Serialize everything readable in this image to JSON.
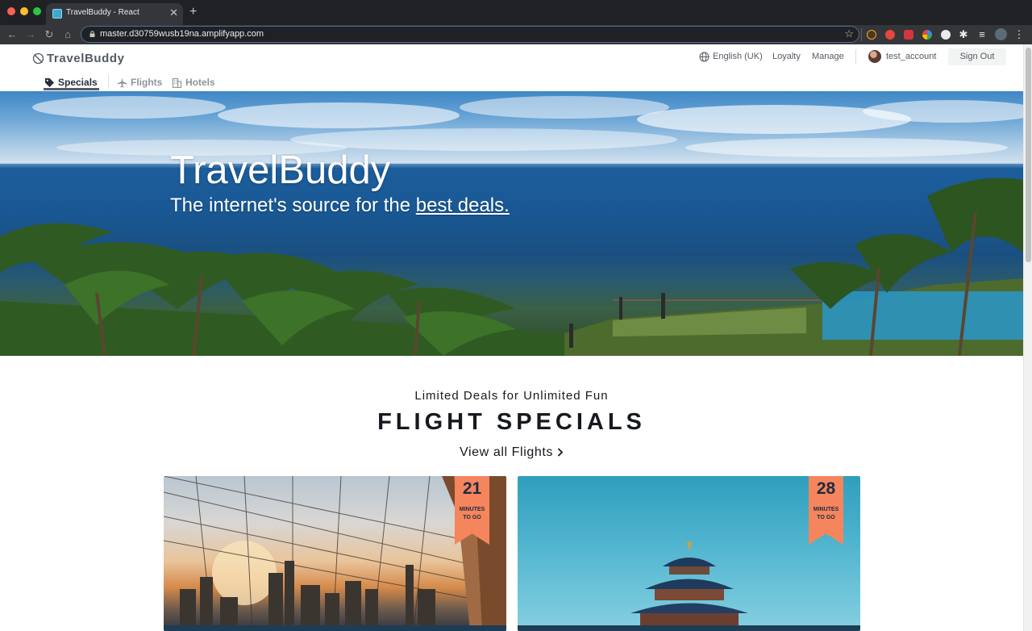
{
  "browser": {
    "tab_title": "TravelBuddy - React",
    "url": "master.d30759wusb19na.amplifyapp.com"
  },
  "header": {
    "logo_text": "TravelBuddy",
    "language": "English (UK)",
    "loyalty": "Loyalty",
    "manage": "Manage",
    "username": "test_account",
    "sign_out": "Sign Out"
  },
  "subnav": {
    "items": [
      {
        "label": "Specials",
        "icon": "tag-icon",
        "active": true
      },
      {
        "label": "Flights",
        "icon": "airplane-icon",
        "active": false
      },
      {
        "label": "Hotels",
        "icon": "building-icon",
        "active": false
      }
    ]
  },
  "hero": {
    "title": "TravelBuddy",
    "subtitle_prefix": "The internet's source for the ",
    "subtitle_link": "best deals."
  },
  "specials": {
    "kicker": "Limited Deals for Unlimited Fun",
    "title": "FLIGHT SPECIALS",
    "view_all": "View all Flights"
  },
  "deals": [
    {
      "minutes": "21",
      "unit_line1": "MINUTES",
      "unit_line2": "TO GO",
      "image": "bridge-city-skyline"
    },
    {
      "minutes": "28",
      "unit_line1": "MINUTES",
      "unit_line2": "TO GO",
      "image": "temple-of-heaven"
    }
  ],
  "colors": {
    "accent_ribbon": "#f4855c",
    "text_dark": "#16191f",
    "nav_gray": "#545b64"
  }
}
